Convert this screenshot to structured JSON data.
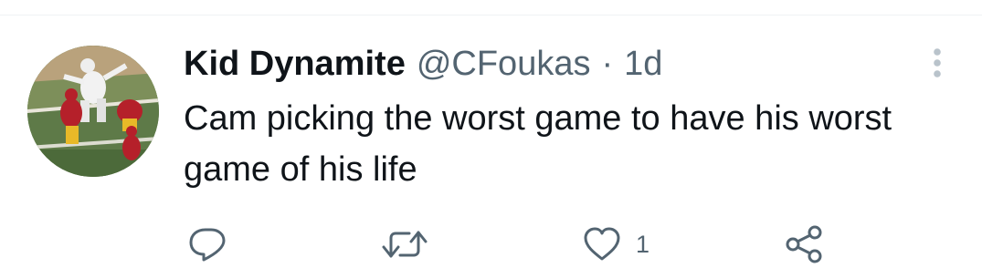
{
  "tweet": {
    "display_name": "Kid Dynamite",
    "handle": "@CFoukas",
    "separator": "·",
    "time": "1d",
    "text": "Cam picking the worst game to have his worst game of his life"
  },
  "actions": {
    "reply_icon": "reply-icon",
    "retweet_icon": "retweet-icon",
    "like_icon": "heart-icon",
    "like_count": "1",
    "share_icon": "share-icon"
  },
  "colors": {
    "primary_text": "#0f1419",
    "secondary_text": "#536471",
    "divider": "#eff3f4"
  }
}
